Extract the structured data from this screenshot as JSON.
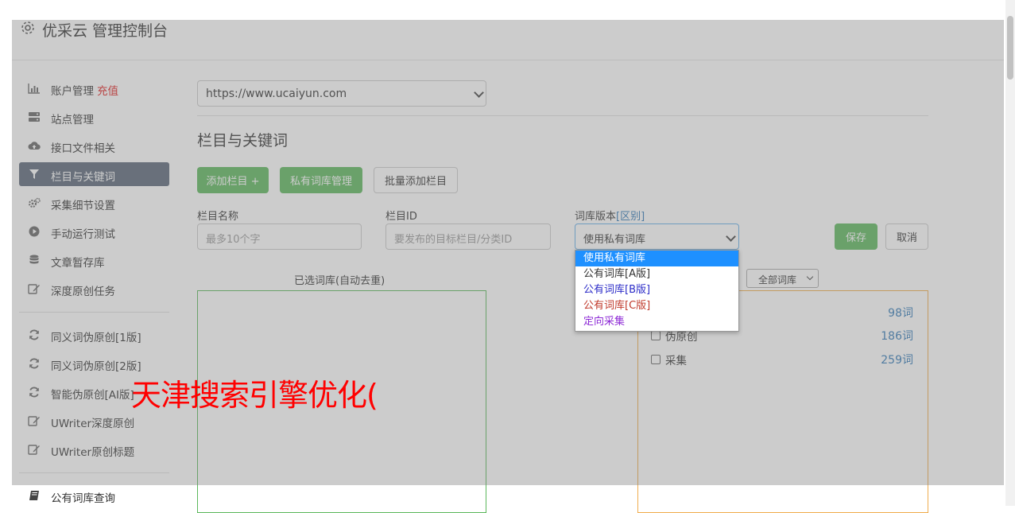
{
  "app": {
    "title": "优采云 管理控制台"
  },
  "sidebar": {
    "groups": [
      [
        {
          "label": "账户管理",
          "extra": "充值",
          "icon": "bar-chart-icon"
        },
        {
          "label": "站点管理",
          "icon": "server-icon"
        },
        {
          "label": "接口文件相关",
          "icon": "cloud-upload-icon"
        },
        {
          "label": "栏目与关键词",
          "icon": "filter-icon",
          "active": true
        },
        {
          "label": "采集细节设置",
          "icon": "cogs-icon"
        },
        {
          "label": "手动运行测试",
          "icon": "play-circle-icon"
        },
        {
          "label": "文章暂存库",
          "icon": "database-icon"
        },
        {
          "label": "深度原创任务",
          "icon": "edit-icon"
        }
      ],
      [
        {
          "label": "同义词伪原创[1版]",
          "icon": "refresh-icon"
        },
        {
          "label": "同义词伪原创[2版]",
          "icon": "refresh-icon"
        },
        {
          "label": "智能伪原创[AI版]",
          "icon": "refresh-icon"
        },
        {
          "label": "UWriter深度原创",
          "icon": "edit-icon"
        },
        {
          "label": "UWriter原创标题",
          "icon": "edit-icon"
        }
      ],
      [
        {
          "label": "公有词库查询",
          "icon": "book-icon"
        }
      ]
    ]
  },
  "main": {
    "site_select": "https://www.ucaiyun.com",
    "section_title": "栏目与关键词",
    "buttons": {
      "add_column": "添加栏目 +",
      "private_lib": "私有词库管理",
      "batch_add": "批量添加栏目",
      "save": "保存",
      "cancel": "取消"
    },
    "fields": {
      "name_label": "栏目名称",
      "name_placeholder": "最多10个字",
      "id_label": "栏目ID",
      "id_placeholder": "要发布的目标栏目/分类ID",
      "version_label": "词库版本",
      "version_link": "[区别]",
      "version_value": "使用私有词库"
    },
    "version_options": [
      "使用私有词库",
      "公有词库[A版]",
      "公有词库[B版]",
      "公有词库[C版]",
      "定向采集"
    ],
    "selected_box_label": "已选词库(自动去重)",
    "filter_select": "全部词库",
    "libraries": [
      {
        "name": "",
        "count": "98词"
      },
      {
        "name": "伪原创",
        "count": "186词"
      },
      {
        "name": "采集",
        "count": "259词"
      }
    ]
  },
  "watermark": "天津搜索引擎优化(",
  "colors": {
    "primary_green": "#5cb85c",
    "active_nav": "#5a6778",
    "link_blue": "#337ab7",
    "accent_red": "#e02020",
    "selected_option": "#1e90ff"
  }
}
